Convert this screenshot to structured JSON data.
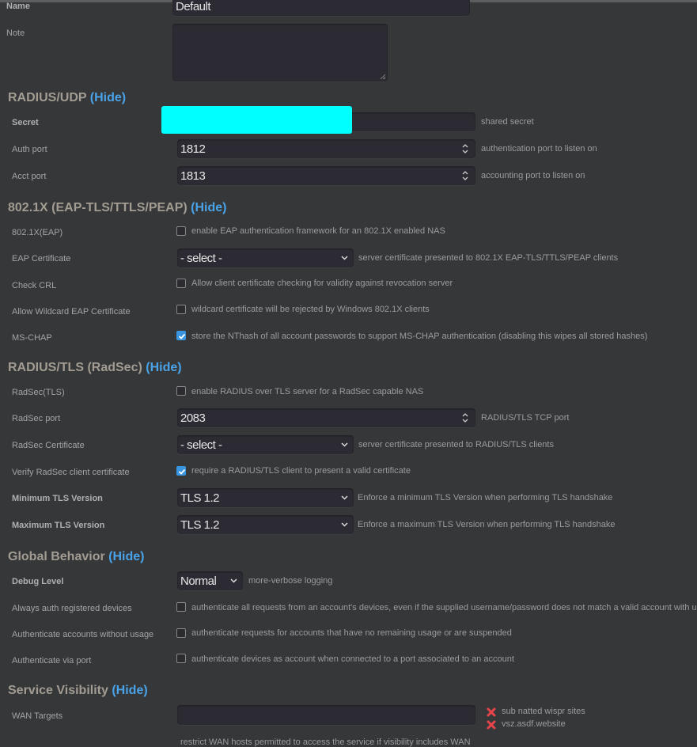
{
  "general": {
    "name_label": "Name",
    "name_value": "Default",
    "note_label": "Note",
    "note_value": ""
  },
  "sections": {
    "radius_udp": {
      "title": "RADIUS/UDP",
      "hide_link": "(Hide)",
      "secret_label": "Secret",
      "secret_help": "shared secret",
      "auth_port_label": "Auth port",
      "auth_port_value": "1812",
      "auth_port_help": "authentication port to listen on",
      "acct_port_label": "Acct port",
      "acct_port_value": "1813",
      "acct_port_help": "accounting port to listen on"
    },
    "eap": {
      "title": "802.1X (EAP-TLS/TTLS/PEAP)",
      "hide_link": "(Hide)",
      "eap_label": "802.1X(EAP)",
      "eap_checked": false,
      "eap_help": "enable EAP authentication framework for an 802.1X enabled NAS",
      "cert_label": "EAP Certificate",
      "cert_value": "- select -",
      "cert_help": "server certificate presented to 802.1X EAP-TLS/TTLS/PEAP clients",
      "crl_label": "Check CRL",
      "crl_checked": false,
      "crl_help": "Allow client certificate checking for validity against revocation server",
      "wildcard_label": "Allow Wildcard EAP Certificate",
      "wildcard_checked": false,
      "wildcard_help": "wildcard certificate will be rejected by Windows 802.1X clients",
      "mschap_label": "MS-CHAP",
      "mschap_checked": true,
      "mschap_help": "store the NThash of all account passwords to support MS-CHAP authentication (disabling this wipes all stored hashes)"
    },
    "radsec": {
      "title": "RADIUS/TLS (RadSec)",
      "hide_link": "(Hide)",
      "enable_label": "RadSec(TLS)",
      "enable_checked": false,
      "enable_help": "enable RADIUS over TLS server for a RadSec capable NAS",
      "port_label": "RadSec port",
      "port_value": "2083",
      "port_help": "RADIUS/TLS TCP port",
      "cert_label": "RadSec Certificate",
      "cert_value": "- select -",
      "cert_help": "server certificate presented to RADIUS/TLS clients",
      "verify_label": "Verify RadSec client certificate",
      "verify_checked": true,
      "verify_help": "require a RADIUS/TLS client to present a valid certificate",
      "min_tls_label": "Minimum TLS Version",
      "min_tls_value": "TLS 1.2",
      "min_tls_help": "Enforce a minimum TLS Version when performing TLS handshake",
      "max_tls_label": "Maximum TLS Version",
      "max_tls_value": "TLS 1.2",
      "max_tls_help": "Enforce a maximum TLS Version when performing TLS handshake"
    },
    "global": {
      "title": "Global Behavior",
      "hide_link": "(Hide)",
      "debug_label": "Debug Level",
      "debug_value": "Normal",
      "debug_help": "more-verbose logging",
      "always_auth_label": "Always auth registered devices",
      "always_auth_checked": false,
      "always_auth_help": "authenticate all requests from an account's devices, even if the supplied username/password does not match a valid account with u",
      "no_usage_label": "Authenticate accounts without usage",
      "no_usage_checked": false,
      "no_usage_help": "authenticate requests for accounts that have no remaining usage or are suspended",
      "via_port_label": "Authenticate via port",
      "via_port_checked": false,
      "via_port_help": "authenticate devices as account when connected to a port associated to an account"
    },
    "visibility": {
      "title": "Service Visibility",
      "hide_link": "(Hide)",
      "wan_label": "WAN Targets",
      "wan_input_value": "",
      "wan_targets": [
        {
          "label": "sub natted wispr sites",
          "icon": "remove-x-icon"
        },
        {
          "label": "vsz.asdf.website",
          "icon": "remove-x-icon"
        }
      ],
      "wan_help": "restrict WAN hosts permitted to access the service if visibility includes WAN"
    }
  },
  "colors": {
    "background": "#353739",
    "input": "#2c2b33",
    "link": "#4aa3e8",
    "checkbox_checked": "#3a95e0",
    "redaction": "#00ffff",
    "remove_icon": "#e8454a"
  }
}
